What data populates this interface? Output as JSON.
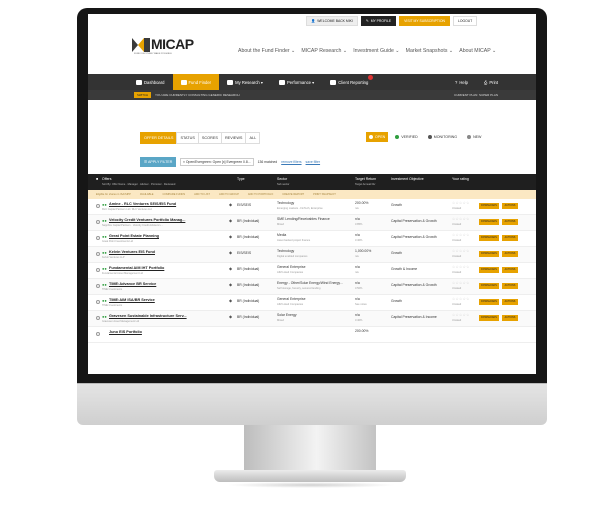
{
  "user_bar": {
    "welcome": "WELCOME BACK MIKI",
    "my_profile": "MY PROFILE",
    "subscription": "VISIT MY SUBSCRIPTION",
    "logout": "LOGOUT"
  },
  "brand": {
    "name": "MICAP",
    "tagline": "FUND DISCOVERY MADE POSSIBLE"
  },
  "nav": [
    "About the Fund Finder ⌄",
    "MICAP Research ⌄",
    "Investment Guide ⌄",
    "Market Snapshots ⌄",
    "About MICAP ⌄"
  ],
  "toolbar": {
    "dashboard": "Dashboard",
    "fund_finder": "Fund Finder",
    "my_research": "My Research ▾",
    "performance": "Performance ▾",
    "client_reporting": "Client Reporting",
    "help": "Help",
    "print": "Print"
  },
  "info_strip": {
    "tag": "SWITCH",
    "message": "YOU ARE CURRENTLY CONSULTING GENERIC RESEARCH",
    "plan": "CURRENT PLAN: SUPER PLAN"
  },
  "tabs": [
    "OFFER DETAILS",
    "STATUS",
    "SCORES",
    "REVIEWS",
    "ALL"
  ],
  "status_filters": [
    "OPEN",
    "VERIFIED",
    "MONITORING",
    "NEW"
  ],
  "filter": {
    "apply_label": "☰ APPLY FILTER",
    "chip": "× Open/Evergreen: Open [x] Evergreen 0.8...",
    "count": "136 matched",
    "remove": "remove filters",
    "save": "save filter"
  },
  "table": {
    "headers": {
      "offers": "Offers",
      "offers_sub": "Sort By: Offer Name  ·  Manager  ·  Adviser  ·  Promoter  ·  Reviewed",
      "type": "Type",
      "sector": "Sector",
      "sector_sub": "Sub sector",
      "target": "Target Return",
      "target_sub": "Target Annual Div",
      "objective": "Investment Objective",
      "rating": "Your rating"
    },
    "subhead": [
      "Eligible for shares in ISA/SIPP",
      "AVAILABLE",
      "COMPARE FUNDS",
      "ADD TO LIST",
      "ADD TO GROUP",
      "ADD TO PORTFOLIO",
      "CREATE REPORT",
      "PRINT SNAPSHOT"
    ],
    "rows": [
      {
        "name": "Amine - RLC Ventures SEIS/EIS Fund",
        "sub": "RLC Capital Partners Ltd / RLC Ventures Ltd",
        "type": "EIS/SEIS",
        "sector": "Technology",
        "sector_sub": "Emerging markets - FinTech, Enterprise",
        "target": "200.00%",
        "target_sub": "n/a",
        "objective": "Growth",
        "rating": "☆☆☆☆☆",
        "rating_sub": "Unrated",
        "dl": "DOWNLOADS",
        "ac": "ACTIONS"
      },
      {
        "name": "Velocity Credit Ventures Portfolio Manag...",
        "sub": "Sapphire Capital Partners  ·  Velocity Credit Advisers L...",
        "type": "BR (Individual)",
        "sector": "SME Lending/Receivables Finance",
        "sector_sub": "Mixed",
        "target": "n/a",
        "target_sub": "3.85%",
        "objective": "Capital Preservation & Growth",
        "rating": "☆☆☆☆☆",
        "rating_sub": "Unrated",
        "dl": "DOWNLOADS",
        "ac": "ACTIONS"
      },
      {
        "name": "Great Point Estate Planning",
        "sub": "Great Point Investments Ltd",
        "type": "BR (Individual)",
        "sector": "Media",
        "sector_sub": "Asset backed project finance",
        "target": "n/a",
        "target_sub": "3.40%",
        "objective": "Capital Preservation & Growth",
        "rating": "☆☆☆☆☆",
        "rating_sub": "Unrated",
        "dl": "DOWNLOADS",
        "ac": "ACTIONS"
      },
      {
        "name": "Kelvin Ventures EIS Fund",
        "sub": "Kelvin Ventures LLP",
        "type": "EIS/SEIS",
        "sector": "Technology",
        "sector_sub": "Digital enabled companies",
        "target": "1,000.00%",
        "target_sub": "n/a",
        "objective": "Growth",
        "rating": "☆☆☆☆☆",
        "rating_sub": "Unrated",
        "dl": "DOWNLOADS",
        "ac": "ACTIONS"
      },
      {
        "name": "Fundamental AiM IHT Portfolio",
        "sub": "Fundamental Asset Management Ltd",
        "type": "BR (Individual)",
        "sector": "General Enterprise",
        "sector_sub": "AIM Listed Companies",
        "target": "n/a",
        "target_sub": "n/a",
        "objective": "Growth & Income",
        "rating": "☆☆☆☆☆",
        "rating_sub": "Unrated",
        "dl": "DOWNLOADS",
        "ac": "ACTIONS"
      },
      {
        "name": "TIME:Advance BR Service",
        "sub": "TIME Investments",
        "type": "BR (Individual)",
        "sector": "Energy - Other/Solar Energy/Wind Energy...",
        "sector_sub": "Self storage, forestry, secured lending",
        "target": "n/a",
        "target_sub": "3.50%",
        "objective": "Capital Preservation & Growth",
        "rating": "☆☆☆☆☆",
        "rating_sub": "Unrated",
        "dl": "DOWNLOADS",
        "ac": "ACTIONS"
      },
      {
        "name": "TIME:AIM ISA/BR Service",
        "sub": "TIME Investments",
        "type": "BR (Individual)",
        "sector": "General Enterprise",
        "sector_sub": "AIM Listed Companies",
        "target": "n/a",
        "target_sub": "See notes",
        "objective": "Growth",
        "rating": "☆☆☆☆☆",
        "rating_sub": "Unrated",
        "dl": "DOWNLOADS",
        "ac": "ACTIONS"
      },
      {
        "name": "Gravesen Sustainable Infrastructure Serv...",
        "sub": "Gravesen Asset Management Ltd",
        "type": "BR (Individual)",
        "sector": "Solar Energy",
        "sector_sub": "Mixed",
        "target": "n/a",
        "target_sub": "3.40%",
        "objective": "Capital Preservation & Income",
        "rating": "☆☆☆☆☆",
        "rating_sub": "Unrated",
        "dl": "DOWNLOADS",
        "ac": "ACTIONS"
      },
      {
        "name": "Juno EIS Portfolio",
        "sub": "",
        "type": "",
        "sector": "",
        "sector_sub": "",
        "target": "200.00%",
        "target_sub": "",
        "objective": "",
        "rating": "",
        "rating_sub": "",
        "dl": "",
        "ac": ""
      }
    ]
  },
  "colors": {
    "accent": "#e7a200",
    "dark": "#1f1f1f",
    "filter_blue": "#5aa6c6"
  }
}
